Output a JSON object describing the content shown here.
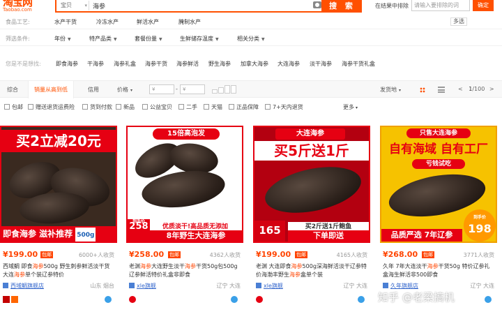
{
  "logo": {
    "cn": "淘宝网",
    "en": "Taobao.com"
  },
  "search": {
    "type": "宝贝",
    "query": "海参",
    "button": "搜 索"
  },
  "refine": {
    "label": "在结果中排除",
    "placeholder": "请输入要排除的词",
    "confirm": "确定"
  },
  "filters": {
    "process": {
      "label": "食品工艺:",
      "items": [
        "水产干货",
        "冷冻水产",
        "鲜活水产",
        "腌制水产"
      ],
      "multi": "多选"
    },
    "conditions": {
      "label": "筛选条件:",
      "items": [
        "年份",
        "特产品类",
        "套餐份量",
        "生鲜储存温度",
        "相关分类"
      ]
    },
    "related": {
      "label": "您是不是想找:",
      "items": [
        "即食海参",
        "干海参",
        "海参礼盒",
        "海参干货",
        "海参鲜活",
        "野生海参",
        "加拿大海参",
        "大连海参",
        "淡干海参",
        "海参干货礼盒"
      ]
    }
  },
  "sortbar": {
    "items": [
      "综合",
      "销量从高到低",
      "信用",
      "价格"
    ],
    "price_from": "¥",
    "price_to": "¥",
    "price_sep": "-",
    "ship_from": "发货地",
    "page": "1",
    "page_total": "/100",
    "prev": "<",
    "next": ">"
  },
  "checks": [
    "包邮",
    "赠送退货运费险",
    "货到付款",
    "新品",
    "公益宝贝",
    "二手",
    "天猫",
    "正品保障",
    "7+天内退货"
  ],
  "more": "更多",
  "products": [
    {
      "banner_top": "买2立减20元",
      "banner_bottom": "即食海参  滋补推荐",
      "weight": "500g",
      "price": "¥199.00",
      "baoyou": "包邮",
      "sales": "6000+人收货",
      "title_pre": "西域鲷 即食",
      "title_hl": "海参",
      "title_post": "500g 野生刺参鲜活淡干货大连",
      "title_hl2": "海参",
      "title_post2": "单个装辽参特价",
      "shop": "西域鲷旗舰店",
      "loc": "山东 烟台"
    },
    {
      "banner_top": "15倍高泡发",
      "banner_bottom": "8年野生大连海参",
      "tag1": "优质淡干!高品质无添加",
      "tag_price": "258",
      "tag_label": "到手价",
      "price": "¥258.00",
      "baoyou": "包邮",
      "sales": "4362人收货",
      "title_pre": "老渊",
      "title_hl": "海参",
      "title_post": "大连野生淡干",
      "title_hl2": "海参",
      "title_post2": "干货50g包500g辽参鲜活特价礼盒非即食",
      "shop": "xle旗舰",
      "loc": "辽宁 大连"
    },
    {
      "banner_top": "大连海参",
      "banner_mid": "买5斤送1斤",
      "tag1": "买2斤送1斤鲍鱼",
      "banner_bottom": "下单即送",
      "tag_price": "165",
      "price": "¥199.00",
      "baoyou": "包邮",
      "sales": "4165人收货",
      "title_pre": "老渊 大连即食",
      "title_hl": "海参",
      "title_post": "500g深海鲜活淡干辽参特价海渤丰野生",
      "title_hl2": "海参",
      "title_post2": "盒单个装",
      "shop": "xle旗舰",
      "loc": "辽宁 大连"
    },
    {
      "banner_top": "只售大连海参",
      "banner_mid": "自有海域 自有工厂",
      "tag1": "亏钱试吃",
      "banner_bottom": "品质严选 7年辽参",
      "tag_price": "198",
      "tag_label": "到手价",
      "price": "¥268.00",
      "baoyou": "包邮",
      "sales": "3771人收货",
      "title_pre": "久年 7年大连淡干",
      "title_hl": "海参",
      "title_post": "干货50g 特价辽参礼盒海生鲜活非500即食",
      "title_hl2": "",
      "title_post2": "",
      "shop": "久年旗舰店",
      "loc": "辽宁 大连"
    }
  ],
  "watermark": "知乎 @老梁搞机",
  "colors": {
    "accent": "#ff5000",
    "price": "#ff4400",
    "banner_red": "#e60012"
  }
}
